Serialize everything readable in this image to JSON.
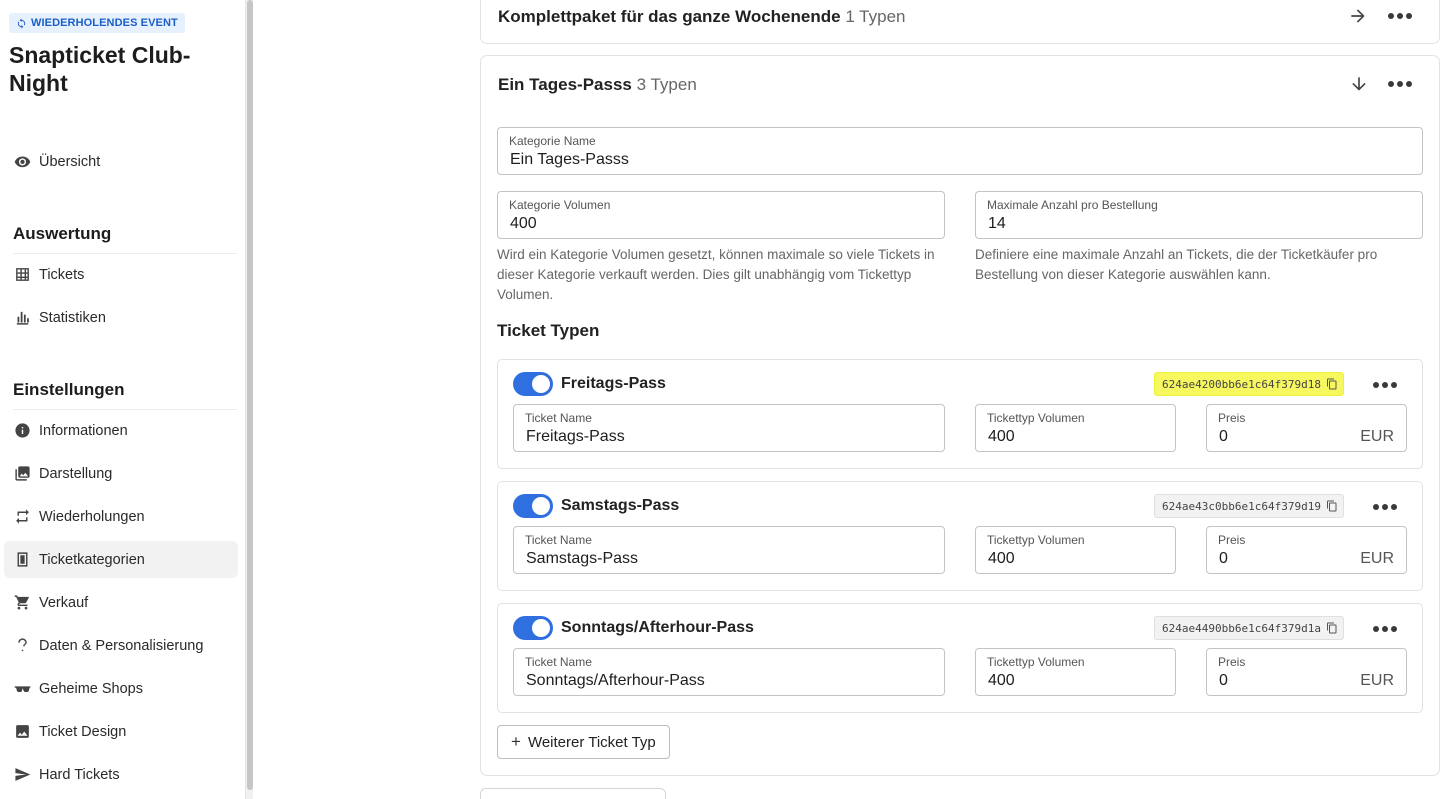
{
  "sidebar": {
    "badge": "WIEDERHOLENDES EVENT",
    "event_title": "Snapticket Club-Night",
    "overview": "Übersicht",
    "section_auswertung": "Auswertung",
    "section_einstellungen": "Einstellungen",
    "items": {
      "tickets": "Tickets",
      "statistiken": "Statistiken",
      "informationen": "Informationen",
      "darstellung": "Darstellung",
      "wiederholungen": "Wiederholungen",
      "ticketkategorien": "Ticketkategorien",
      "verkauf": "Verkauf",
      "daten": "Daten & Personalisierung",
      "geheime_shops": "Geheime Shops",
      "ticket_design": "Ticket Design",
      "hard_tickets": "Hard Tickets"
    }
  },
  "categories": [
    {
      "name": "Komplettpaket für das ganze Wochenende",
      "count": "1 Typen"
    },
    {
      "name": "Ein Tages-Passs",
      "count": "3 Typen"
    }
  ],
  "form": {
    "category_name_label": "Kategorie Name",
    "category_name_value": "Ein Tages-Passs",
    "volume_label": "Kategorie Volumen",
    "volume_value": "400",
    "max_label": "Maximale Anzahl pro Bestellung",
    "max_value": "14",
    "volume_help": "Wird ein Kategorie Volumen gesetzt, können maximale so viele Tickets in dieser Kategorie verkauft werden. Dies gilt unabhängig vom Tickettyp Volumen.",
    "max_help": "Definiere eine maximale Anzahl an Tickets, die der Ticketkäufer pro Bestellung von dieser Kategorie auswählen kann.",
    "ticket_types_title": "Ticket Typen"
  },
  "ticket_labels": {
    "name": "Ticket Name",
    "volume": "Tickettyp Volumen",
    "price": "Preis",
    "currency": "EUR"
  },
  "tickets": [
    {
      "name": "Freitags-Pass",
      "id": "624ae4200bb6e1c64f379d18",
      "volume": "400",
      "price": "0",
      "enabled": true
    },
    {
      "name": "Samstags-Pass",
      "id": "624ae43c0bb6e1c64f379d19",
      "volume": "400",
      "price": "0",
      "enabled": true
    },
    {
      "name": "Sonntags/Afterhour-Pass",
      "id": "624ae4490bb6e1c64f379d1a",
      "volume": "400",
      "price": "0",
      "enabled": true
    }
  ],
  "add_ticket_type": "Weiterer Ticket Typ",
  "colors": {
    "accent": "#2f6fe0",
    "badge_bg": "#e7f0fd",
    "highlight": "#f7f760"
  }
}
